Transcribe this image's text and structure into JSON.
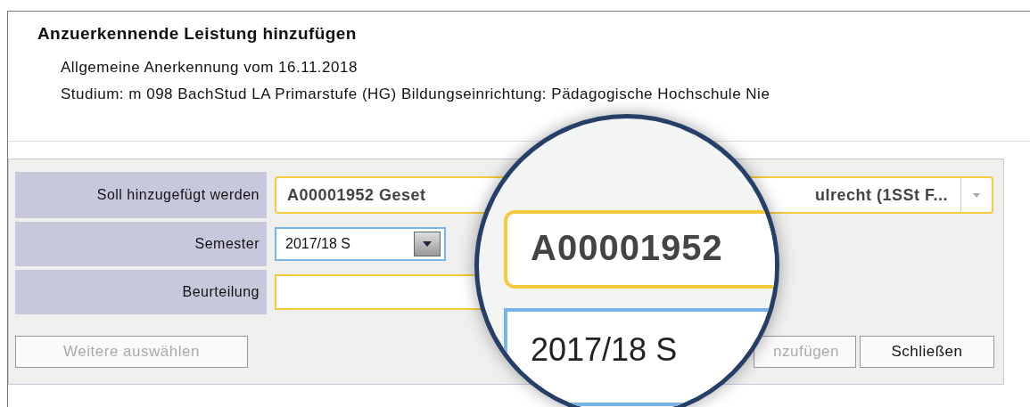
{
  "dialog": {
    "title": "Anzuerkennende Leistung hinzufügen",
    "info_lines": [
      "Allgemeine Anerkennung vom 16.11.2018",
      "Studium: m 098 BachStud LA Primarstufe (HG) Bildungseinrichtung: Pädagogische Hochschule Nie"
    ]
  },
  "form": {
    "rows": [
      {
        "label": "Soll hinzugefügt werden",
        "kind": "combobox",
        "value_start": "A00001952 Geset",
        "value_end": "ulrecht (1SSt F...",
        "focused": false
      },
      {
        "label": "Semester",
        "kind": "dropdown",
        "value_start": "2017/18 S",
        "focused": true
      },
      {
        "label": "Beurteilung",
        "kind": "text",
        "focused": false
      }
    ],
    "buttons": [
      {
        "label": "Weitere auswählen",
        "disabled": true
      },
      {
        "label": "nzufügen",
        "disabled": true
      },
      {
        "label": "Schließen",
        "disabled": false
      }
    ]
  },
  "magnifier": {
    "items": [
      {
        "kind": "combobox",
        "text": "A00001952"
      },
      {
        "kind": "dropdown",
        "text": "2017/18 S"
      }
    ]
  }
}
